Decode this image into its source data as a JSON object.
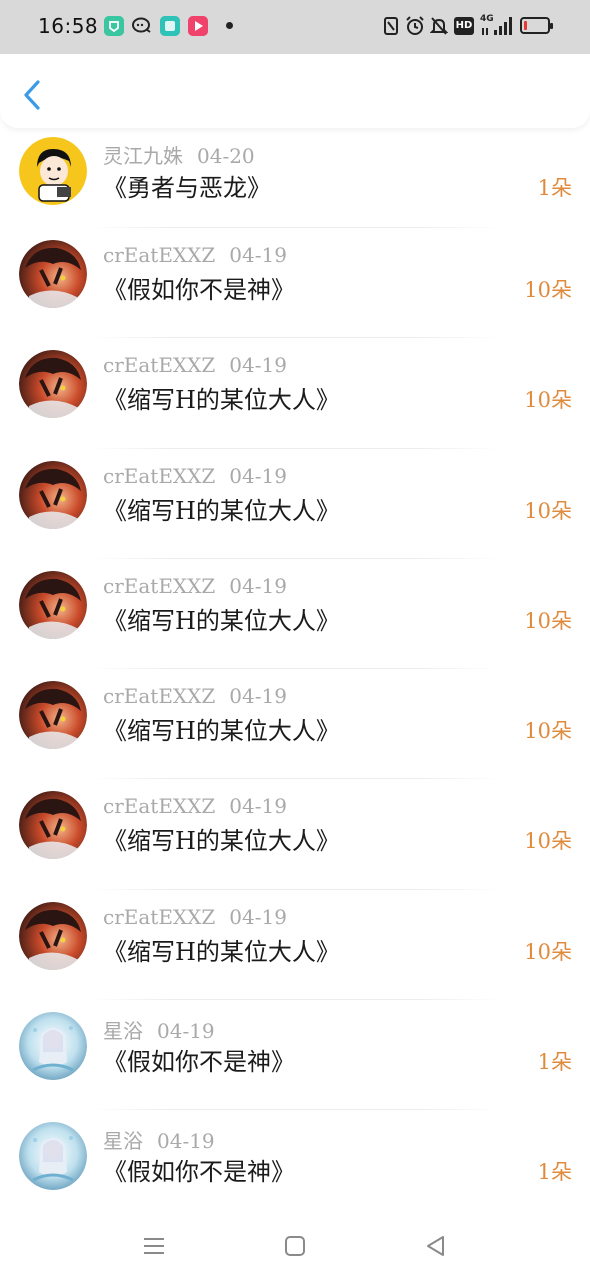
{
  "status_bar": {
    "time": "16:58",
    "icons": [
      "app-green-icon",
      "chat-icon",
      "app-teal-icon",
      "video-app-icon",
      "dot-icon",
      "nfc-icon",
      "alarm-icon",
      "mute-bell-icon",
      "hd-icon",
      "signal-4g-icon",
      "battery-icon"
    ],
    "network": "4G",
    "hd_label": "HD",
    "battery_level": 0.15
  },
  "header": {
    "back_icon": "chevron-left-icon",
    "accent_color": "#3a9be8"
  },
  "colors": {
    "amount": "#e08a3c",
    "meta": "#a9a9a9",
    "title": "#1b1b1b"
  },
  "records": [
    {
      "user": "灵江九姝",
      "date": "04-20",
      "title": "《勇者与恶龙》",
      "amount": "1朵",
      "avatar": "cartoon-avatar"
    },
    {
      "user": "crEatEXXZ",
      "date": "04-19",
      "title": "《假如你不是神》",
      "amount": "10朵",
      "avatar": "anime-avatar-red"
    },
    {
      "user": "crEatEXXZ",
      "date": "04-19",
      "title": "《缩写H的某位大人》",
      "amount": "10朵",
      "avatar": "anime-avatar-red"
    },
    {
      "user": "crEatEXXZ",
      "date": "04-19",
      "title": "《缩写H的某位大人》",
      "amount": "10朵",
      "avatar": "anime-avatar-red"
    },
    {
      "user": "crEatEXXZ",
      "date": "04-19",
      "title": "《缩写H的某位大人》",
      "amount": "10朵",
      "avatar": "anime-avatar-red"
    },
    {
      "user": "crEatEXXZ",
      "date": "04-19",
      "title": "《缩写H的某位大人》",
      "amount": "10朵",
      "avatar": "anime-avatar-red"
    },
    {
      "user": "crEatEXXZ",
      "date": "04-19",
      "title": "《缩写H的某位大人》",
      "amount": "10朵",
      "avatar": "anime-avatar-red"
    },
    {
      "user": "crEatEXXZ",
      "date": "04-19",
      "title": "《缩写H的某位大人》",
      "amount": "10朵",
      "avatar": "anime-avatar-red"
    },
    {
      "user": "星浴",
      "date": "04-19",
      "title": "《假如你不是神》",
      "amount": "1朵",
      "avatar": "anime-avatar-blue"
    },
    {
      "user": "星浴",
      "date": "04-19",
      "title": "《假如你不是神》",
      "amount": "1朵",
      "avatar": "anime-avatar-blue"
    }
  ],
  "nav_bar": {
    "buttons": [
      "menu-icon",
      "home-square-icon",
      "back-triangle-icon"
    ]
  }
}
